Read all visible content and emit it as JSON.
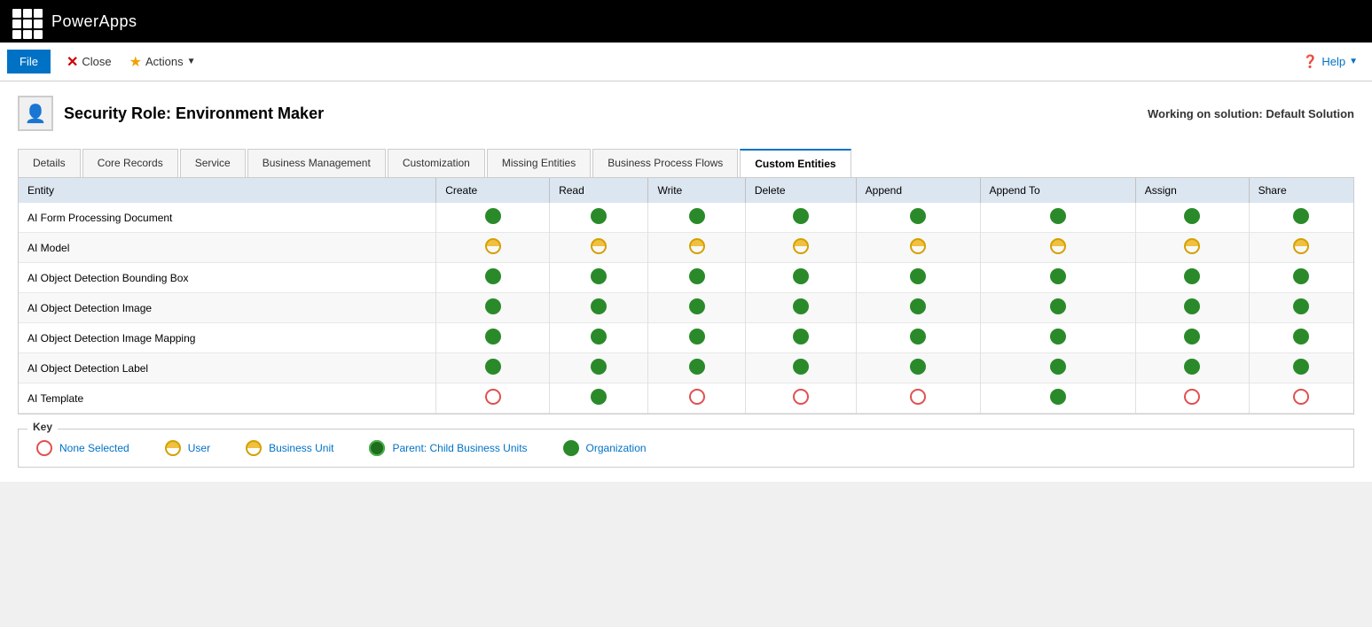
{
  "app": {
    "title": "PowerApps"
  },
  "toolbar": {
    "file_label": "File",
    "close_label": "Close",
    "actions_label": "Actions",
    "help_label": "Help"
  },
  "page": {
    "title": "Security Role: Environment Maker",
    "solution_info": "Working on solution: Default Solution"
  },
  "tabs": [
    {
      "id": "details",
      "label": "Details",
      "active": false
    },
    {
      "id": "core-records",
      "label": "Core Records",
      "active": false
    },
    {
      "id": "service",
      "label": "Service",
      "active": false
    },
    {
      "id": "business-management",
      "label": "Business Management",
      "active": false
    },
    {
      "id": "customization",
      "label": "Customization",
      "active": false
    },
    {
      "id": "missing-entities",
      "label": "Missing Entities",
      "active": false
    },
    {
      "id": "business-process-flows",
      "label": "Business Process Flows",
      "active": false
    },
    {
      "id": "custom-entities",
      "label": "Custom Entities",
      "active": true
    }
  ],
  "table": {
    "columns": [
      "Entity",
      "Create",
      "Read",
      "Write",
      "Delete",
      "Append",
      "Append To",
      "Assign",
      "Share"
    ],
    "rows": [
      {
        "entity": "AI Form Processing Document",
        "create": "org",
        "read": "org",
        "write": "org",
        "delete": "org",
        "append": "org",
        "append_to": "org",
        "assign": "org",
        "share": "org"
      },
      {
        "entity": "AI Model",
        "create": "user",
        "read": "user",
        "write": "user",
        "delete": "user",
        "append": "user",
        "append_to": "user",
        "assign": "user",
        "share": "user"
      },
      {
        "entity": "AI Object Detection Bounding Box",
        "create": "org",
        "read": "org",
        "write": "org",
        "delete": "org",
        "append": "org",
        "append_to": "org",
        "assign": "org",
        "share": "org"
      },
      {
        "entity": "AI Object Detection Image",
        "create": "org",
        "read": "org",
        "write": "org",
        "delete": "org",
        "append": "org",
        "append_to": "org",
        "assign": "org",
        "share": "org"
      },
      {
        "entity": "AI Object Detection Image Mapping",
        "create": "org",
        "read": "org",
        "write": "org",
        "delete": "org",
        "append": "org",
        "append_to": "org",
        "assign": "org",
        "share": "org"
      },
      {
        "entity": "AI Object Detection Label",
        "create": "org",
        "read": "org",
        "write": "org",
        "delete": "org",
        "append": "org",
        "append_to": "org",
        "assign": "org",
        "share": "org"
      },
      {
        "entity": "AI Template",
        "create": "none",
        "read": "org",
        "write": "none",
        "delete": "none",
        "append": "none",
        "append_to": "org",
        "assign": "none",
        "share": "none"
      }
    ]
  },
  "key": {
    "title": "Key",
    "items": [
      {
        "id": "none",
        "type": "none",
        "label": "None Selected"
      },
      {
        "id": "user",
        "type": "user",
        "label": "User"
      },
      {
        "id": "business-unit",
        "type": "business-unit",
        "label": "Business Unit"
      },
      {
        "id": "parent",
        "type": "parent",
        "label": "Parent: Child Business Units"
      },
      {
        "id": "org",
        "type": "org",
        "label": "Organization"
      }
    ]
  }
}
